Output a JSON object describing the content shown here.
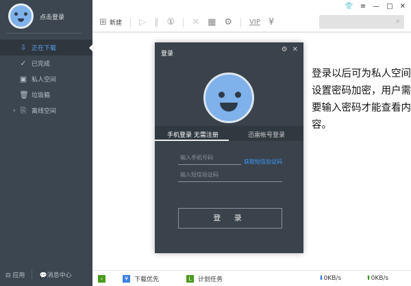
{
  "sidebar": {
    "login_label": "点击登录",
    "items": [
      {
        "label": "正在下载"
      },
      {
        "label": "已完成"
      },
      {
        "label": "私人空间"
      },
      {
        "label": "垃圾箱"
      },
      {
        "label": "离线空间"
      }
    ],
    "apps_label": "应用",
    "messages_label": "消息中心"
  },
  "toolbar": {
    "new_label": "新建"
  },
  "dialog": {
    "title": "登录",
    "tab_phone": "手机登录 无需注册",
    "tab_account": "迅雷帐号登录",
    "phone_placeholder": "输入手机号码",
    "sms_link": "获取短信验证码",
    "code_placeholder": "输入短信验证码",
    "login_button": "登 录"
  },
  "note": "登录以后可为私人空间设置密码加密，用户需要输入密码才能查看内容。",
  "status": {
    "priority_label": "下载优先",
    "schedule_label": "计划任务",
    "down_speed": "0KB/s",
    "up_speed": "0KB/s"
  }
}
